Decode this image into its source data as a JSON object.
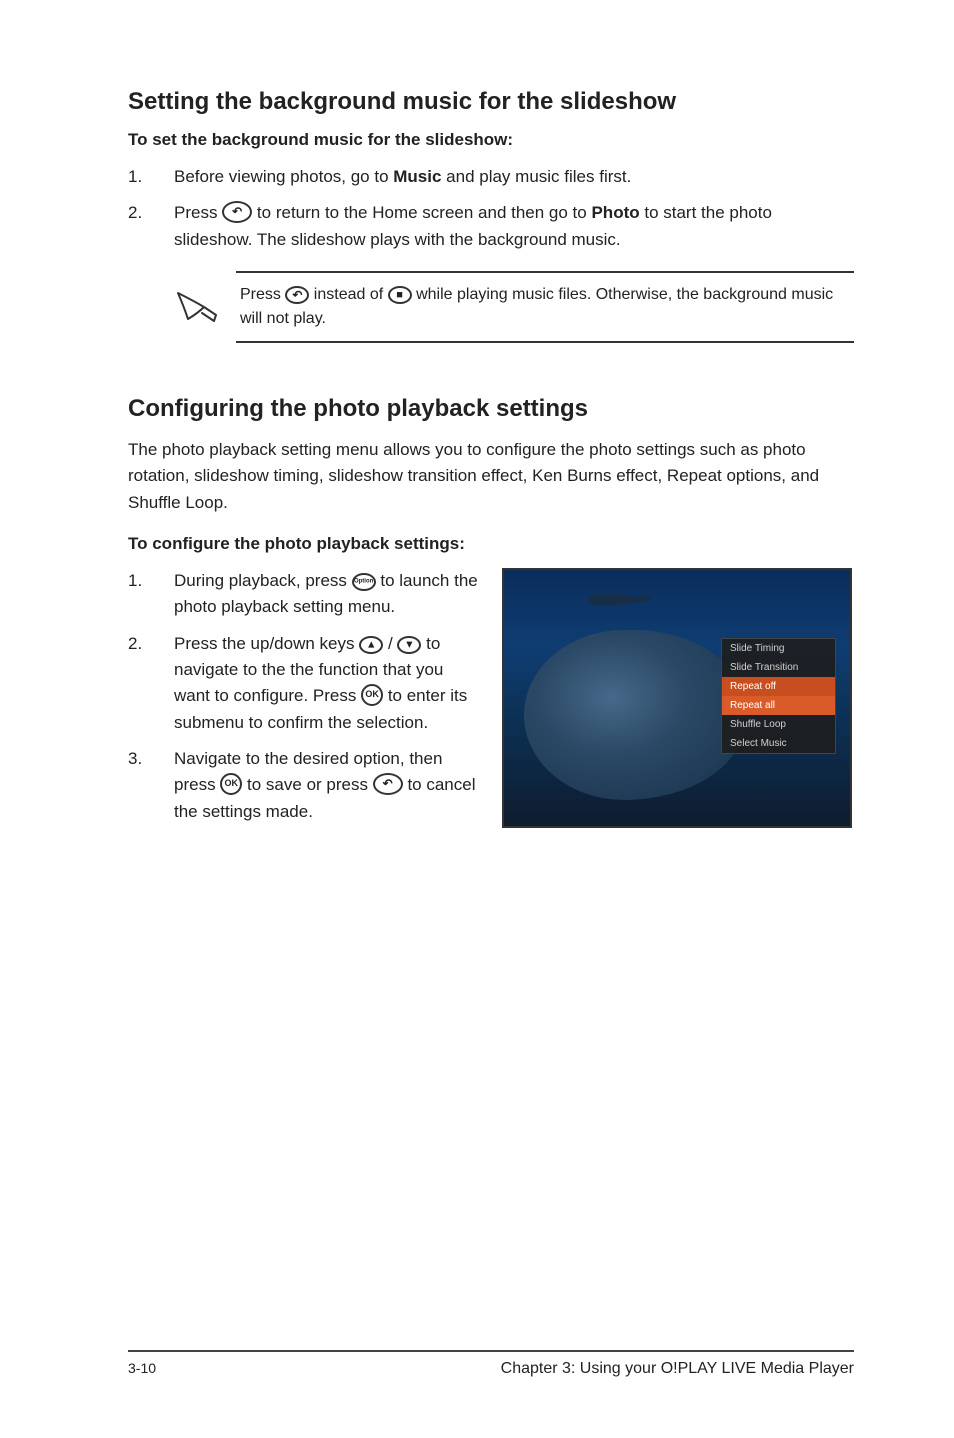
{
  "section1": {
    "heading": "Setting the background music for the slideshow",
    "subhead": "To set the background music for the slideshow:",
    "step1_num": "1.",
    "step1_a": "Before viewing photos, go to ",
    "step1_b": "Music",
    "step1_c": " and play music files first.",
    "step2_num": "2.",
    "step2_a": "Press ",
    "step2_b": " to return to the Home screen and then go to ",
    "step2_c": "Photo",
    "step2_d": " to start the photo slideshow. The slideshow plays with the background music.",
    "note_a": "Press ",
    "note_b": " instead of ",
    "note_c": " while playing music files. Otherwise, the background music will not play."
  },
  "section2": {
    "heading": "Configuring the photo playback settings",
    "intro": "The photo playback setting menu allows you to configure the photo settings such as photo rotation, slideshow timing, slideshow transition effect, Ken Burns effect, Repeat options, and Shuffle Loop.",
    "subhead": "To configure the photo playback settings:",
    "step1_num": "1.",
    "step1_a": "During playback, press ",
    "step1_b": " to launch the photo playback setting menu.",
    "step2_num": "2.",
    "step2_a": "Press the ",
    "step2_upd": "up/down keys",
    "step2_b": " / ",
    "step2_c": " to navigate to the the function that you want to configure. Press ",
    "step2_d": " to enter its submenu to confirm the selection.",
    "step3_num": "3.",
    "step3_a": "Navigate to the desired option, then press ",
    "step3_b": " to save or press ",
    "step3_c": " to cancel the settings made."
  },
  "menu": {
    "m1": "Slide Timing",
    "m2": "Slide Transition",
    "m3": "Repeat off",
    "m4": "Repeat all",
    "m5": "Shuffle Loop",
    "m6": "Select Music"
  },
  "footer": {
    "page": "3-10",
    "chapter": "Chapter 3: Using your O!PLAY LIVE Media Player"
  },
  "icons": {
    "back": "↶",
    "stop": "■",
    "ok": "OK",
    "up": "▴",
    "down": "▾",
    "option": "Option"
  }
}
